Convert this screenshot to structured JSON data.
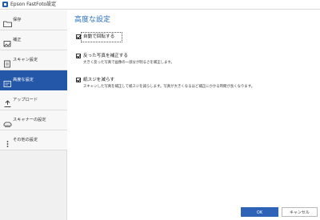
{
  "window": {
    "title": "Epson FastFoto設定"
  },
  "sidebar": {
    "items": [
      {
        "label": "保存",
        "icon": "folder-icon",
        "active": false
      },
      {
        "label": "補正",
        "icon": "adjust-image-icon",
        "active": false
      },
      {
        "label": "スキャン設定",
        "icon": "scan-settings-icon",
        "active": false
      },
      {
        "label": "高度な設定",
        "icon": "advanced-settings-icon",
        "active": true
      },
      {
        "label": "アップロード",
        "icon": "upload-icon",
        "active": false
      },
      {
        "label": "スキャナーの設定",
        "icon": "scanner-icon",
        "active": false
      },
      {
        "label": "その他の設定",
        "icon": "more-icon",
        "active": false
      }
    ]
  },
  "main": {
    "title": "高度な設定",
    "options": [
      {
        "label": "自動で回転する",
        "description": "",
        "checked": true
      },
      {
        "label": "反った写真を補正する",
        "description": "大きく反った写真で画像の一部分が明るさを補正します。",
        "checked": true
      },
      {
        "label": "紙スジを減らす",
        "description": "スキャンした写真を補正して紙スジを減らします。写真が大きくなるほど補正にかかる時間が長くなります。",
        "checked": true
      }
    ]
  },
  "buttons": {
    "ok": "OK",
    "cancel": "キャンセル"
  },
  "colors": {
    "accent": "#2457a8",
    "title_blue": "#2a6fbf",
    "ok_button": "#2e63b8"
  }
}
